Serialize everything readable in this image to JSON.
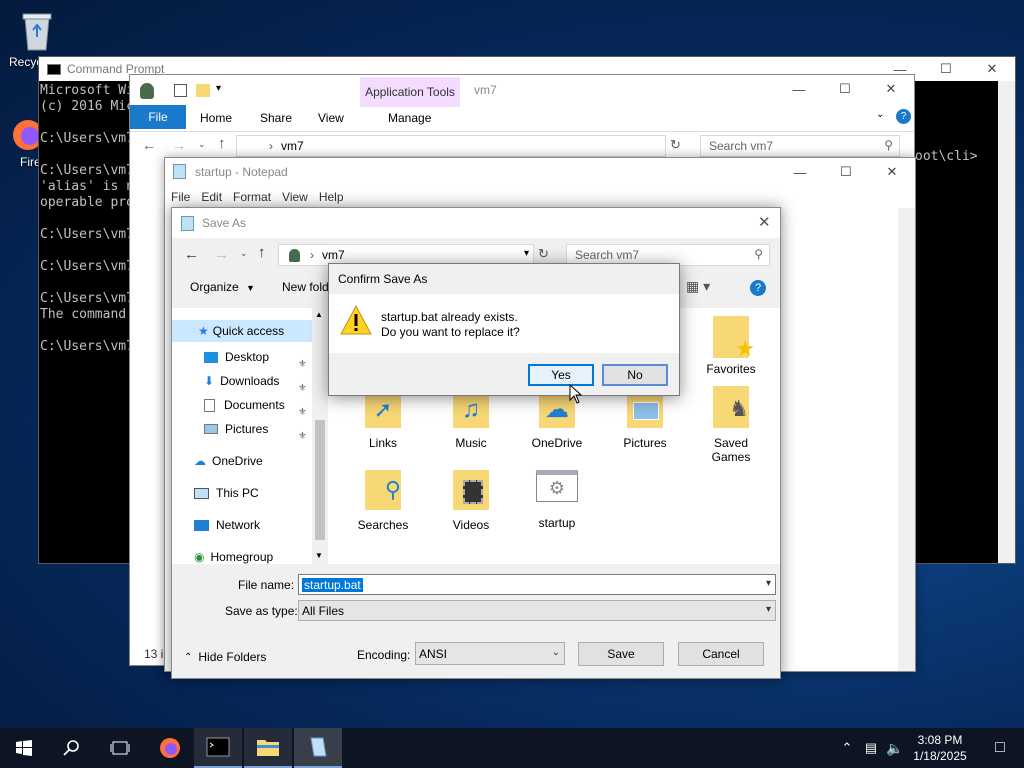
{
  "desktop": {
    "recycle_label": "Recycl",
    "firefox_label": "Fire"
  },
  "cmd": {
    "title": "Command Prompt",
    "lines": "Microsoft Wi\n(c) 2016 Mic\n\nC:\\Users\\vm7\n\nC:\\Users\\vm7\n'alias' is n\noperable pro\n\nC:\\Users\\vm7\n\nC:\\Users\\vm7\n\nC:\\Users\\vm7\nThe command\n\nC:\\Users\\vm7",
    "right_fragment": "oot\\cli>"
  },
  "explorer": {
    "app_tools": "Application Tools",
    "title": "vm7",
    "tabs": [
      "File",
      "Home",
      "Share",
      "View"
    ],
    "manage": "Manage",
    "path": "vm7",
    "search": "Search vm7",
    "status": "13 i"
  },
  "notepad": {
    "title": "startup - Notepad",
    "menu": [
      "File",
      "Edit",
      "Format",
      "View",
      "Help"
    ]
  },
  "saveas": {
    "title": "Save As",
    "path": "vm7",
    "search_placeholder": "Search vm7",
    "organize": "Organize",
    "newfolder": "New fold",
    "nav": {
      "quick_access": "Quick access",
      "desktop": "Desktop",
      "downloads": "Downloads",
      "documents": "Documents",
      "pictures": "Pictures",
      "onedrive": "OneDrive",
      "thispc": "This PC",
      "network": "Network",
      "homegroup": "Homegroup"
    },
    "folders": {
      "favorites": "Favorites",
      "links": "Links",
      "music": "Music",
      "onedrive": "OneDrive",
      "pictures": "Pictures",
      "saved_games": "Saved Games",
      "searches": "Searches",
      "videos": "Videos",
      "startup": "startup"
    },
    "filename_label": "File name:",
    "filename_value": "startup.bat",
    "savetype_label": "Save as type:",
    "savetype_value": "All Files",
    "hide_folders": "Hide Folders",
    "encoding_label": "Encoding:",
    "encoding_value": "ANSI",
    "save": "Save",
    "cancel": "Cancel"
  },
  "confirm": {
    "title": "Confirm Save As",
    "line1": "startup.bat already exists.",
    "line2": "Do you want to replace it?",
    "yes": "Yes",
    "no": "No"
  },
  "taskbar": {
    "time": "3:08 PM",
    "date": "1/18/2025"
  },
  "colors": {
    "accent": "#0078d7",
    "app_tools_tab": "#f3dcff",
    "taskbar": "#0d1423"
  }
}
